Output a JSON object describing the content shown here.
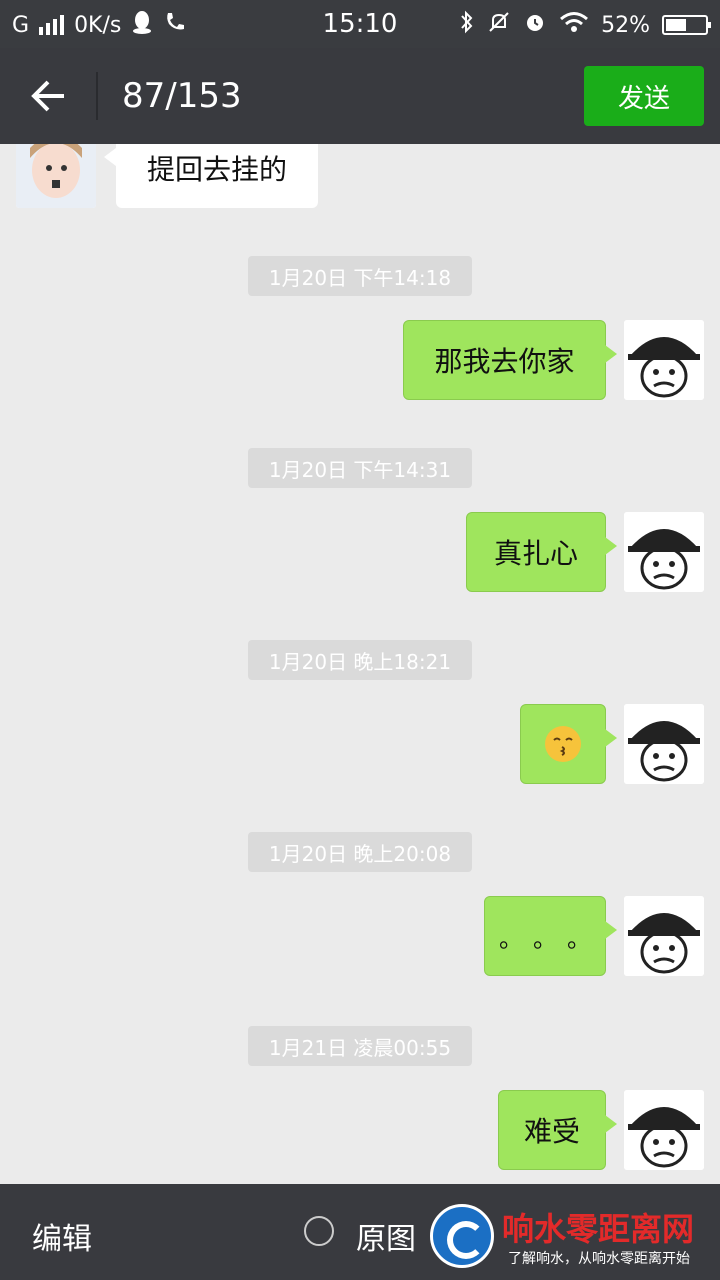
{
  "status_bar": {
    "network": "G",
    "speed": "0K/s",
    "time": "15:10",
    "battery_percent": "52%",
    "battery_level": 0.52
  },
  "header": {
    "title": "87/153",
    "send_label": "发送"
  },
  "messages": [
    {
      "side": "left",
      "text": "提回去挂的"
    },
    {
      "timestamp": "1月20日 下午14:18"
    },
    {
      "side": "right",
      "text": "那我去你家"
    },
    {
      "timestamp": "1月20日 下午14:31"
    },
    {
      "side": "right",
      "text": "真扎心"
    },
    {
      "timestamp": "1月20日 晚上18:21"
    },
    {
      "side": "right",
      "emoji": "kissing-face"
    },
    {
      "timestamp": "1月20日 晚上20:08"
    },
    {
      "side": "right",
      "text": "。。。"
    },
    {
      "timestamp": "1月21日 凌晨00:55"
    },
    {
      "side": "right",
      "text": "难受"
    }
  ],
  "bottom_bar": {
    "edit_label": "编辑",
    "original_label": "原图"
  },
  "watermark": {
    "title": "响水零距离网",
    "subtitle": "了解响水，从响水零距离开始"
  },
  "colors": {
    "bubble_green": "#9fe55d",
    "send_green": "#1aad19",
    "bar_dark": "#393a3f",
    "chat_bg": "#ebebeb"
  }
}
